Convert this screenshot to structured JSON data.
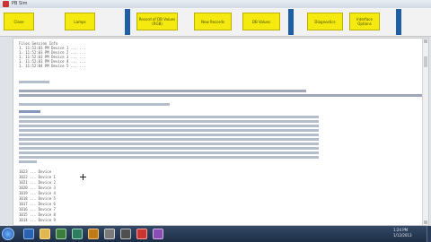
{
  "window": {
    "title": "PB Sim"
  },
  "toolbar": {
    "buttons": [
      {
        "label": "Close"
      },
      {
        "label": "Lamps"
      },
      {
        "label": "Record of DB Values (RGB)"
      },
      {
        "label": "New Records"
      },
      {
        "label": "DB Values"
      },
      {
        "label": "Diagnostics"
      },
      {
        "label": "Interface Options"
      }
    ]
  },
  "content": {
    "header_lines": [
      "Files Session Info",
      "1. 11:52:03 PM  Device 1 ... ...",
      "1. 11:52:03 PM  Device 2 ... ...",
      "1. 11:52:03 PM  Device 3 ... ...",
      "1. 11:52:03 PM  Device 4 ... ...",
      "1. 11:52:04 PM  Device 5 ... ..."
    ],
    "bottom_lines": [
      "1023 ... Device",
      "1022 ... Device 1",
      "1021 ... Device 2",
      "1020 ... Device 3",
      "1019 ... Device 4",
      "1018 ... Device 5",
      "1017 ... Device 6",
      "1016 ... Device 7",
      "1015 ... Device 8",
      "1014 ... Device 9"
    ]
  },
  "taskbar": {
    "clock_time": "1:24 PM",
    "clock_date": "1/12/2013"
  },
  "colors": {
    "button_yellow": "#f4ea10",
    "separator_blue": "#1f5fa8",
    "taskbar": "#24364f"
  }
}
